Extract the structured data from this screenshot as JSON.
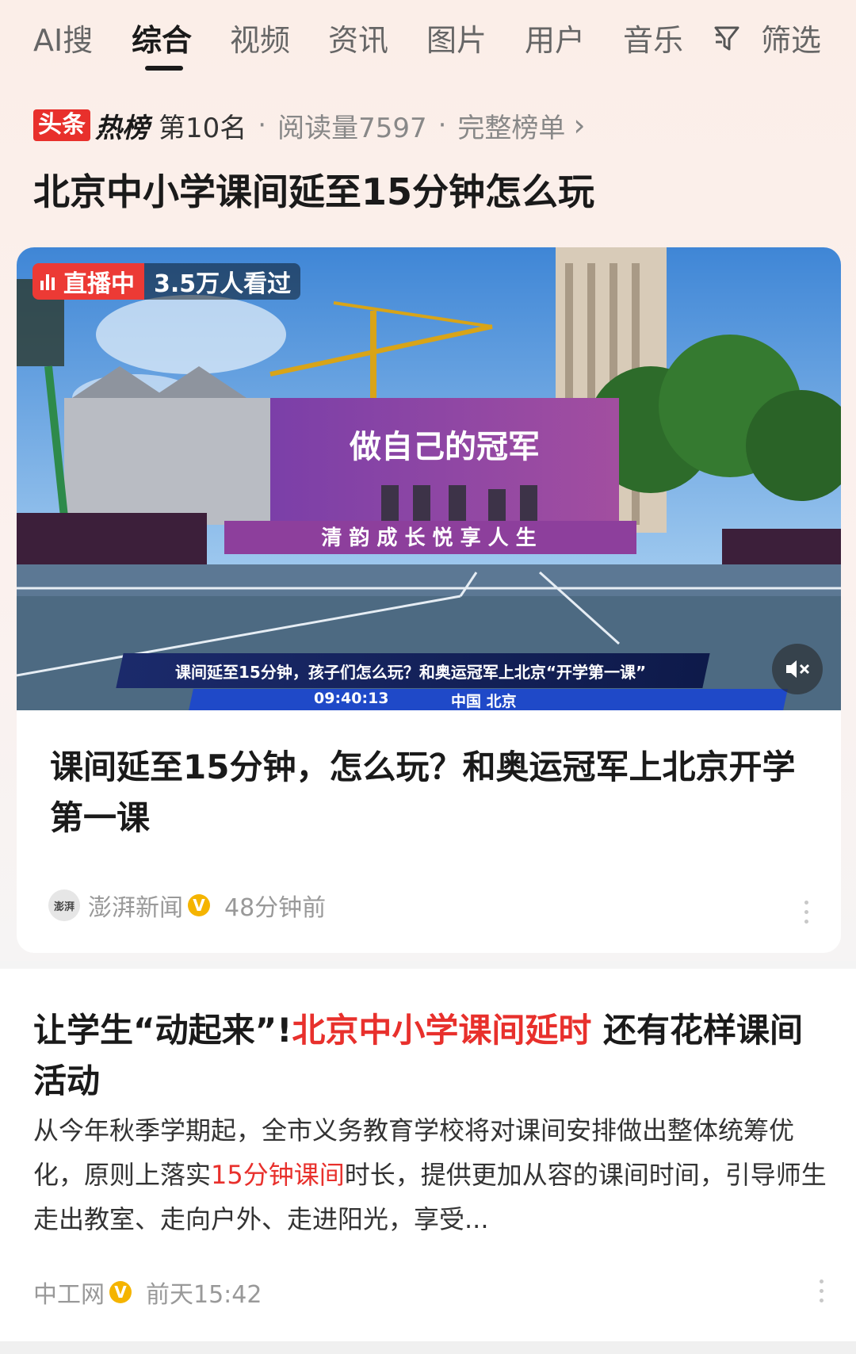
{
  "tabs": [
    {
      "label": "AI搜",
      "active": false
    },
    {
      "label": "综合",
      "active": true
    },
    {
      "label": "视频",
      "active": false
    },
    {
      "label": "资讯",
      "active": false
    },
    {
      "label": "图片",
      "active": false
    },
    {
      "label": "用户",
      "active": false
    },
    {
      "label": "音乐",
      "active": false
    }
  ],
  "filter": {
    "label": "筛选",
    "icon": "filter-icon"
  },
  "hotlist": {
    "brand1": "头条",
    "brand2": "热榜",
    "rank": "第10名",
    "sep": "·",
    "reads": "阅读量7597",
    "full_list": "完整榜单",
    "chevron": "›",
    "title": "北京中小学课间延至15分钟怎么玩"
  },
  "video_card": {
    "live_label": "直播中",
    "viewers": "3.5万人看过",
    "caption": "课间延至15分钟，孩子们怎么玩？和奥运冠军上北京“开学第一课”",
    "timestamp": "09:40:13",
    "location": "中国 北京",
    "banner_main": "做自己的冠军",
    "banner_bottom": "清 韵 成 长  悦 享 人 生",
    "title": "课间延至15分钟，怎么玩？和奥运冠军上北京开学第一课",
    "source": "澎湃新闻",
    "source_avatar_text": "澎湃",
    "verified": "V",
    "time": "48分钟前"
  },
  "article2": {
    "title_pre": "让学生“动起来”!",
    "title_highlight": "北京中小学课间延时",
    "title_post": " 还有花样课间活动",
    "body_pre": "从今年秋季学期起，全市义务教育学校将对课间安排做出整体统筹优化，原则上落实",
    "body_highlight": "15分钟课间",
    "body_post": "时长，提供更加从容的课间时间，引导师生走出教室、走向户外、走进阳光，享受...",
    "source": "中工网",
    "verified": "V",
    "time": "前天15:42"
  },
  "colors": {
    "accent_red": "#e8302c",
    "verified_gold": "#f5b400"
  }
}
